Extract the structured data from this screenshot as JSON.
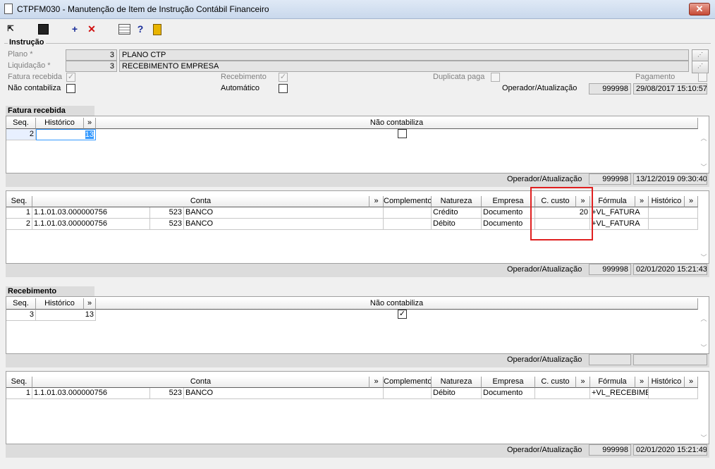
{
  "window": {
    "title": "CTPFM030 - Manutenção de Item de Instrução Contábil Financeiro",
    "close_label": "✕"
  },
  "toolbar": {
    "icons": [
      "exit-icon",
      "save-icon",
      "add-icon",
      "delete-icon",
      "calendar-icon",
      "help-icon",
      "door-icon"
    ],
    "add_glyph": "+",
    "delete_glyph": "✕",
    "help_glyph": "?"
  },
  "instrucao": {
    "section_title": "Instrução",
    "plano_label": "Plano *",
    "plano_code": "3",
    "plano_desc": "PLANO CTP",
    "liquidacao_label": "Liquidação *",
    "liquidacao_code": "3",
    "liquidacao_desc": "RECEBIMENTO EMPRESA",
    "fatura_recebida_label": "Fatura recebida",
    "recebimento_label": "Recebimento",
    "duplicata_paga_label": "Duplicata paga",
    "pagamento_label": "Pagamento",
    "nao_contabiliza_label": "Não contabiliza",
    "automatico_label": "Automático",
    "operador_label": "Operador/Atualização",
    "operador": "999998",
    "atualizacao": "29/08/2017 15:10:57",
    "lookup_glyph": "⋰"
  },
  "fatura": {
    "section_title": "Fatura recebida",
    "col_seq": "Seq.",
    "col_historico": "Histórico",
    "col_more": "»",
    "col_nao_contabiliza": "Não contabiliza",
    "row": {
      "seq": "2",
      "historico": "13"
    },
    "operador_label": "Operador/Atualização",
    "operador": "999998",
    "atualizacao": "13/12/2019 09:30:40"
  },
  "contas_cols": {
    "seq": "Seq.",
    "conta": "Conta",
    "more": "»",
    "complemento": "Complemento",
    "natureza": "Natureza",
    "empresa": "Empresa",
    "ccusto": "C. custo",
    "formula": "Fórmula",
    "historico": "Histórico"
  },
  "fatura_contas": {
    "rows": [
      {
        "seq": "1",
        "conta": "1.1.01.03.000000756",
        "cod": "523",
        "nome": "BANCO",
        "complemento": "",
        "natureza": "Crédito",
        "empresa": "Documento",
        "ccusto": "20",
        "formula": "+VL_FATURA",
        "historico": ""
      },
      {
        "seq": "2",
        "conta": "1.1.01.03.000000756",
        "cod": "523",
        "nome": "BANCO",
        "complemento": "",
        "natureza": "Débito",
        "empresa": "Documento",
        "ccusto": "",
        "formula": "+VL_FATURA",
        "historico": ""
      }
    ],
    "operador_label": "Operador/Atualização",
    "operador": "999998",
    "atualizacao": "02/01/2020 15:21:43"
  },
  "recebimento": {
    "section_title": "Recebimento",
    "row": {
      "seq": "3",
      "historico": "13",
      "check": "✓"
    },
    "operador_label": "Operador/Atualização"
  },
  "receb_contas": {
    "rows": [
      {
        "seq": "1",
        "conta": "1.1.01.03.000000756",
        "cod": "523",
        "nome": "BANCO",
        "complemento": "",
        "natureza": "Débito",
        "empresa": "Documento",
        "ccusto": "",
        "formula": "+VL_RECEBIMEN",
        "historico": ""
      }
    ],
    "operador_label": "Operador/Atualização",
    "operador": "999998",
    "atualizacao": "02/01/2020 15:21:49"
  },
  "colors": {
    "highlight": "#e02020",
    "selection": "#3399ff"
  }
}
